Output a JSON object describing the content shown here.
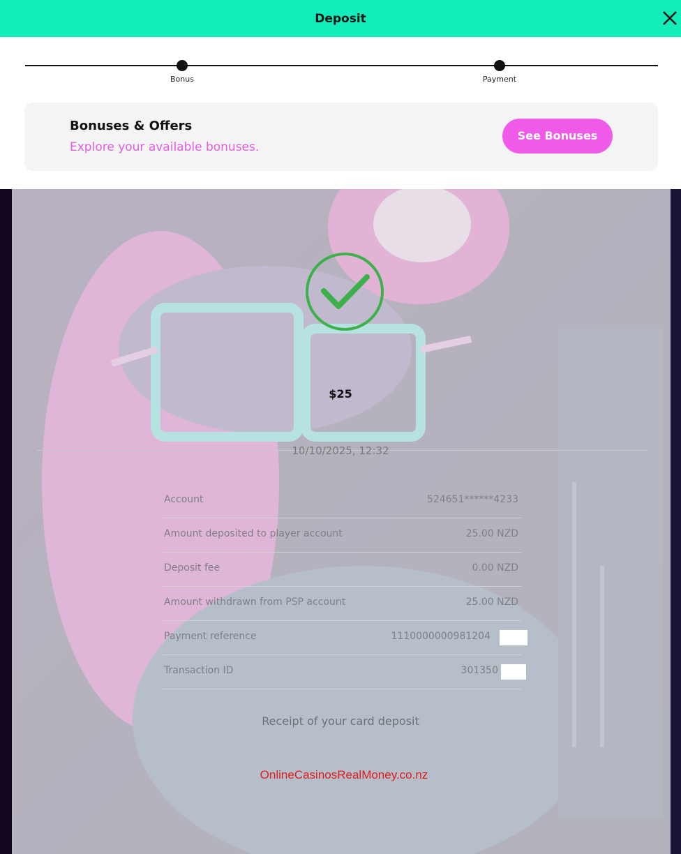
{
  "header": {
    "title": "Deposit",
    "close_icon": "close-icon",
    "background_color": "#12edbb"
  },
  "stepper": {
    "steps": [
      {
        "label": "Bonus"
      },
      {
        "label": "Payment"
      }
    ]
  },
  "offers": {
    "title": "Bonuses & Offers",
    "subtitle": "Explore your available bonuses.",
    "button_label": "See Bonuses",
    "accent_color": "#ef5ae8"
  },
  "receipt": {
    "status_icon": "check-circle-icon",
    "amount": "$25",
    "datetime": "10/10/2025, 12:32",
    "rows": [
      {
        "label": "Account",
        "value": "524651******4233"
      },
      {
        "label": "Amount deposited to player account",
        "value": "25.00 NZD"
      },
      {
        "label": "Deposit fee",
        "value": "0.00 NZD"
      },
      {
        "label": "Amount withdrawn from PSP account",
        "value": "25.00 NZD"
      },
      {
        "label": "Payment reference",
        "value": "1110000000981204"
      },
      {
        "label": "Transaction ID",
        "value": "301350"
      }
    ],
    "caption": "Receipt of your card deposit",
    "success_color": "#3db04b"
  },
  "watermark": "OnlineCasinosRealMoney.co.nz"
}
